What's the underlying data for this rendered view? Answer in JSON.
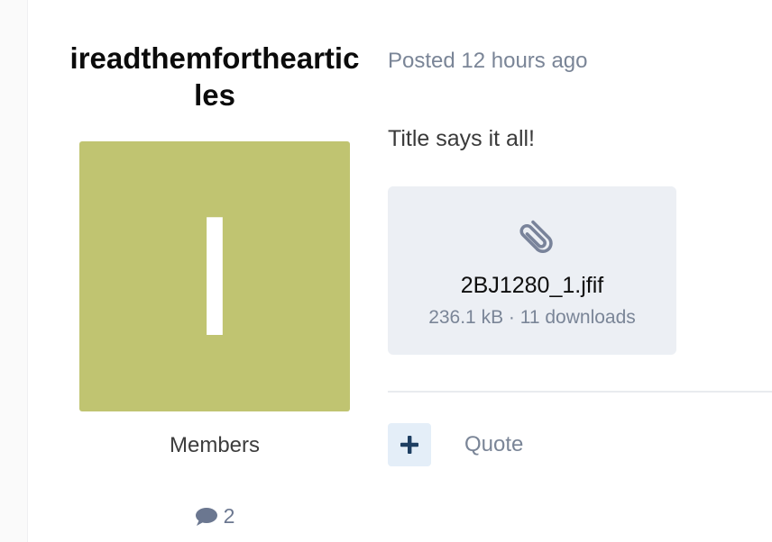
{
  "author": {
    "name": "ireadthemforthearticles",
    "avatar_letter": "I",
    "avatar_color": "#c0c471",
    "group": "Members",
    "post_count": "2"
  },
  "post": {
    "meta": "Posted 12 hours ago",
    "body": "Title says it all!"
  },
  "attachment": {
    "icon": "paperclip-icon",
    "filename": "2BJ1280_1.jfif",
    "details": "236.1 kB · 11 downloads"
  },
  "actions": {
    "reaction_icon": "plus-icon",
    "quote_label": "Quote"
  },
  "colors": {
    "accent": "#1e3f62",
    "muted_text": "#7a8597",
    "attachment_bg": "#eceff4",
    "reaction_bg": "#e4eef8"
  }
}
